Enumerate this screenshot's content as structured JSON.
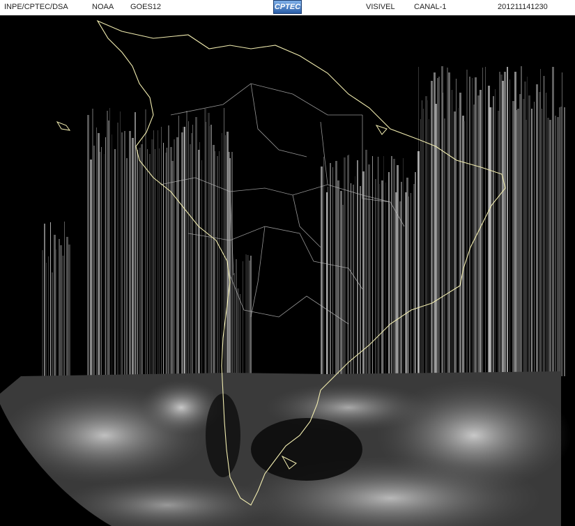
{
  "header": {
    "organization": "INPE/CPTEC/DSA",
    "agency": "NOAA",
    "satellite": "GOES12",
    "band": "VISIVEL",
    "channel": "CANAL-1",
    "timestamp": "201211141230",
    "logo_text": "CPTEC"
  },
  "image": {
    "kind": "satellite-visible-channel",
    "region": "south-america",
    "colors": {
      "background": "#000000",
      "coastline": "#f4f0b0",
      "borders": "#bfbfbf",
      "cloud": "#cfcfcf"
    }
  }
}
